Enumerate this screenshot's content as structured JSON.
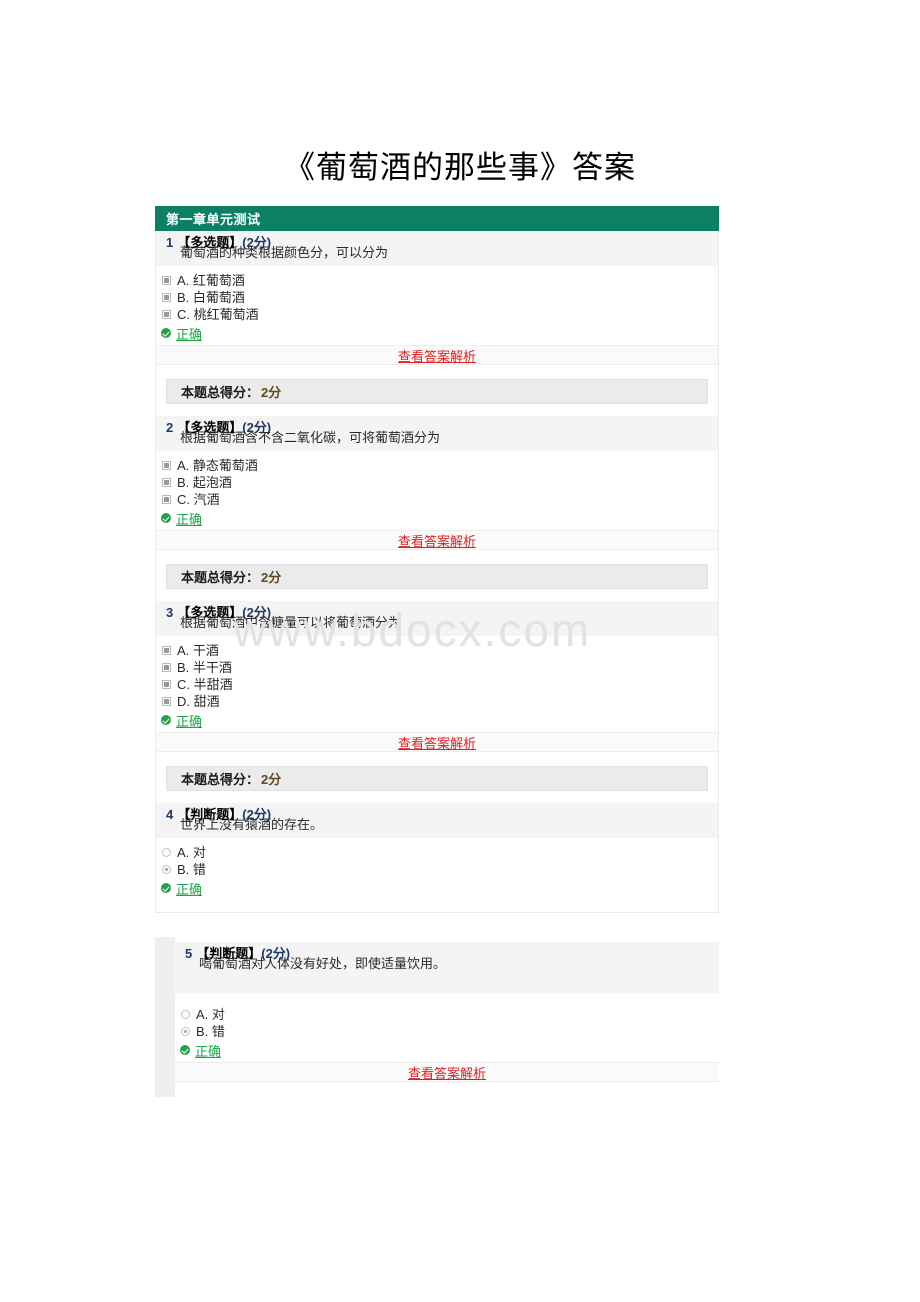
{
  "page": {
    "title": "《葡萄酒的那些事》答案",
    "watermark": "www.bdocx.com"
  },
  "chapter": {
    "header": "第一章单元测试"
  },
  "labels": {
    "analysis_link": "查看答案解析",
    "score_label": "本题总得分：",
    "result_correct": "正确",
    "multi_choice_type": "【多选题】",
    "judge_type": "【判断题】",
    "points_2": "(2分)"
  },
  "colors": {
    "header_green": "#0b8065",
    "correct_green": "#17a642",
    "analysis_red": "#e02020",
    "stem_gray": "#f4f4f4",
    "score_gray": "#ebebeb"
  },
  "questions": [
    {
      "num": "1",
      "type": "【多选题】",
      "points": "(2分)",
      "text": "葡萄酒的种类根据颜色分，可以分为",
      "input": "checkbox",
      "options": [
        {
          "label": "A. 红葡萄酒",
          "checked": true
        },
        {
          "label": "B. 白葡萄酒",
          "checked": true
        },
        {
          "label": "C. 桃红葡萄酒",
          "checked": true
        }
      ],
      "result": "正确",
      "analysis": "查看答案解析",
      "score_label": "本题总得分：",
      "score_value": "2分"
    },
    {
      "num": "2",
      "type": "【多选题】",
      "points": "(2分)",
      "text": "根据葡萄酒含不含二氧化碳，可将葡萄酒分为",
      "input": "checkbox",
      "options": [
        {
          "label": "A. 静态葡萄酒",
          "checked": true
        },
        {
          "label": "B. 起泡酒",
          "checked": true
        },
        {
          "label": "C. 汽酒",
          "checked": true
        }
      ],
      "result": "正确",
      "analysis": "查看答案解析",
      "score_label": "本题总得分：",
      "score_value": "2分"
    },
    {
      "num": "3",
      "type": "【多选题】",
      "points": "(2分)",
      "text": "根据葡萄酒中含糖量可以将葡萄酒分为",
      "input": "checkbox",
      "options": [
        {
          "label": "A. 干酒",
          "checked": true
        },
        {
          "label": "B. 半干酒",
          "checked": true
        },
        {
          "label": "C. 半甜酒",
          "checked": true
        },
        {
          "label": "D. 甜酒",
          "checked": true
        }
      ],
      "result": "正确",
      "analysis": "查看答案解析",
      "score_label": "本题总得分：",
      "score_value": "2分"
    },
    {
      "num": "4",
      "type": "【判断题】",
      "points": "(2分)",
      "text": "世界上没有猿酒的存在。",
      "input": "radio",
      "options": [
        {
          "label": "A. 对",
          "checked": false
        },
        {
          "label": "B. 错",
          "checked": true
        }
      ],
      "result": "正确"
    },
    {
      "num": "5",
      "type": "【判断题】",
      "points": "(2分)",
      "text": "喝葡萄酒对人体没有好处，即使适量饮用。",
      "input": "radio",
      "options": [
        {
          "label": "A. 对",
          "checked": false
        },
        {
          "label": "B. 错",
          "checked": true
        }
      ],
      "result": "正确",
      "analysis": "查看答案解析"
    }
  ]
}
